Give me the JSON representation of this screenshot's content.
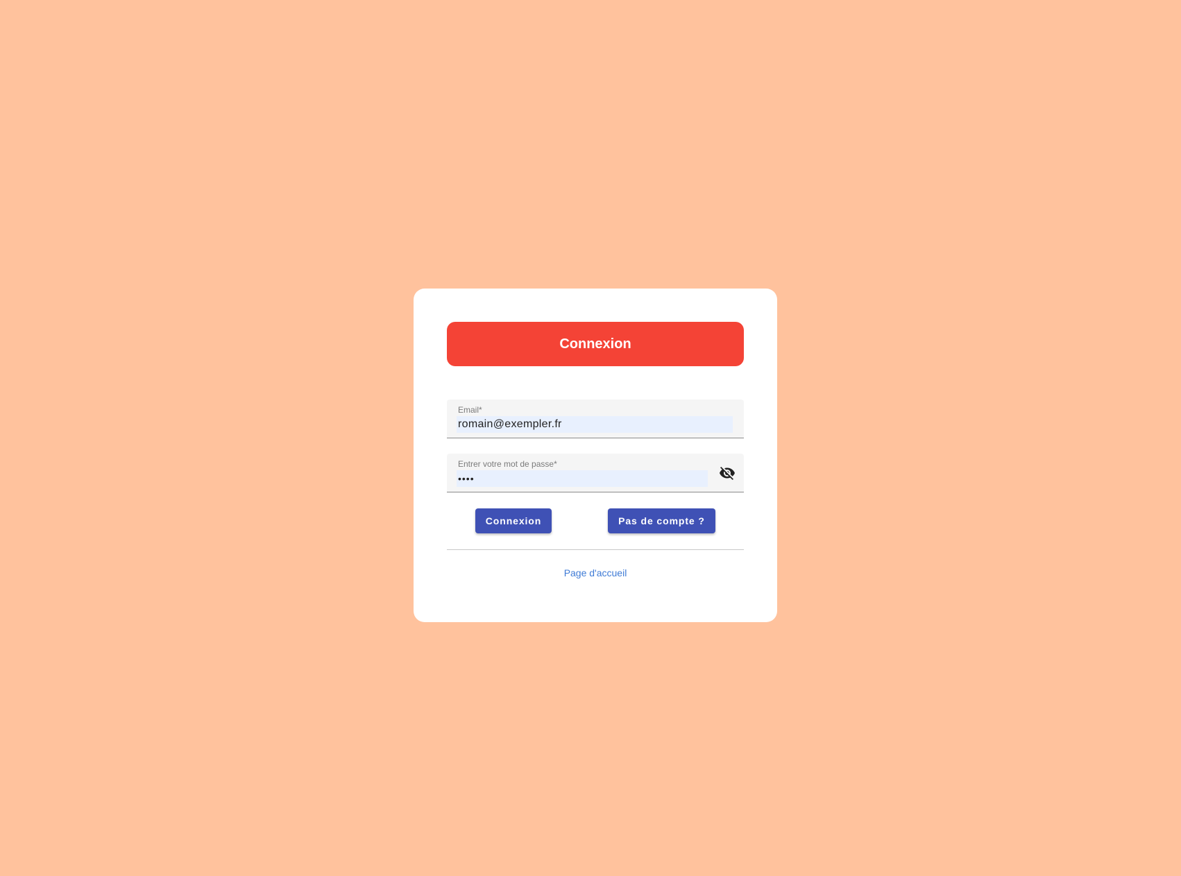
{
  "colors": {
    "background": "#ffc29d",
    "header": "#f44336",
    "button": "#3f51b5",
    "link": "#3f7bd6",
    "autofill": "#e8f0fe"
  },
  "login_card": {
    "title": "Connexion",
    "email_field": {
      "label": "Email*",
      "value": "romain@exempler.fr"
    },
    "password_field": {
      "label": "Entrer votre mot de passe*",
      "value": "••••",
      "toggle_icon": "eye-off-icon"
    },
    "login_button_label": "Connexion",
    "register_button_label": "Pas de compte ?",
    "home_link_label": "Page d'accueil"
  }
}
